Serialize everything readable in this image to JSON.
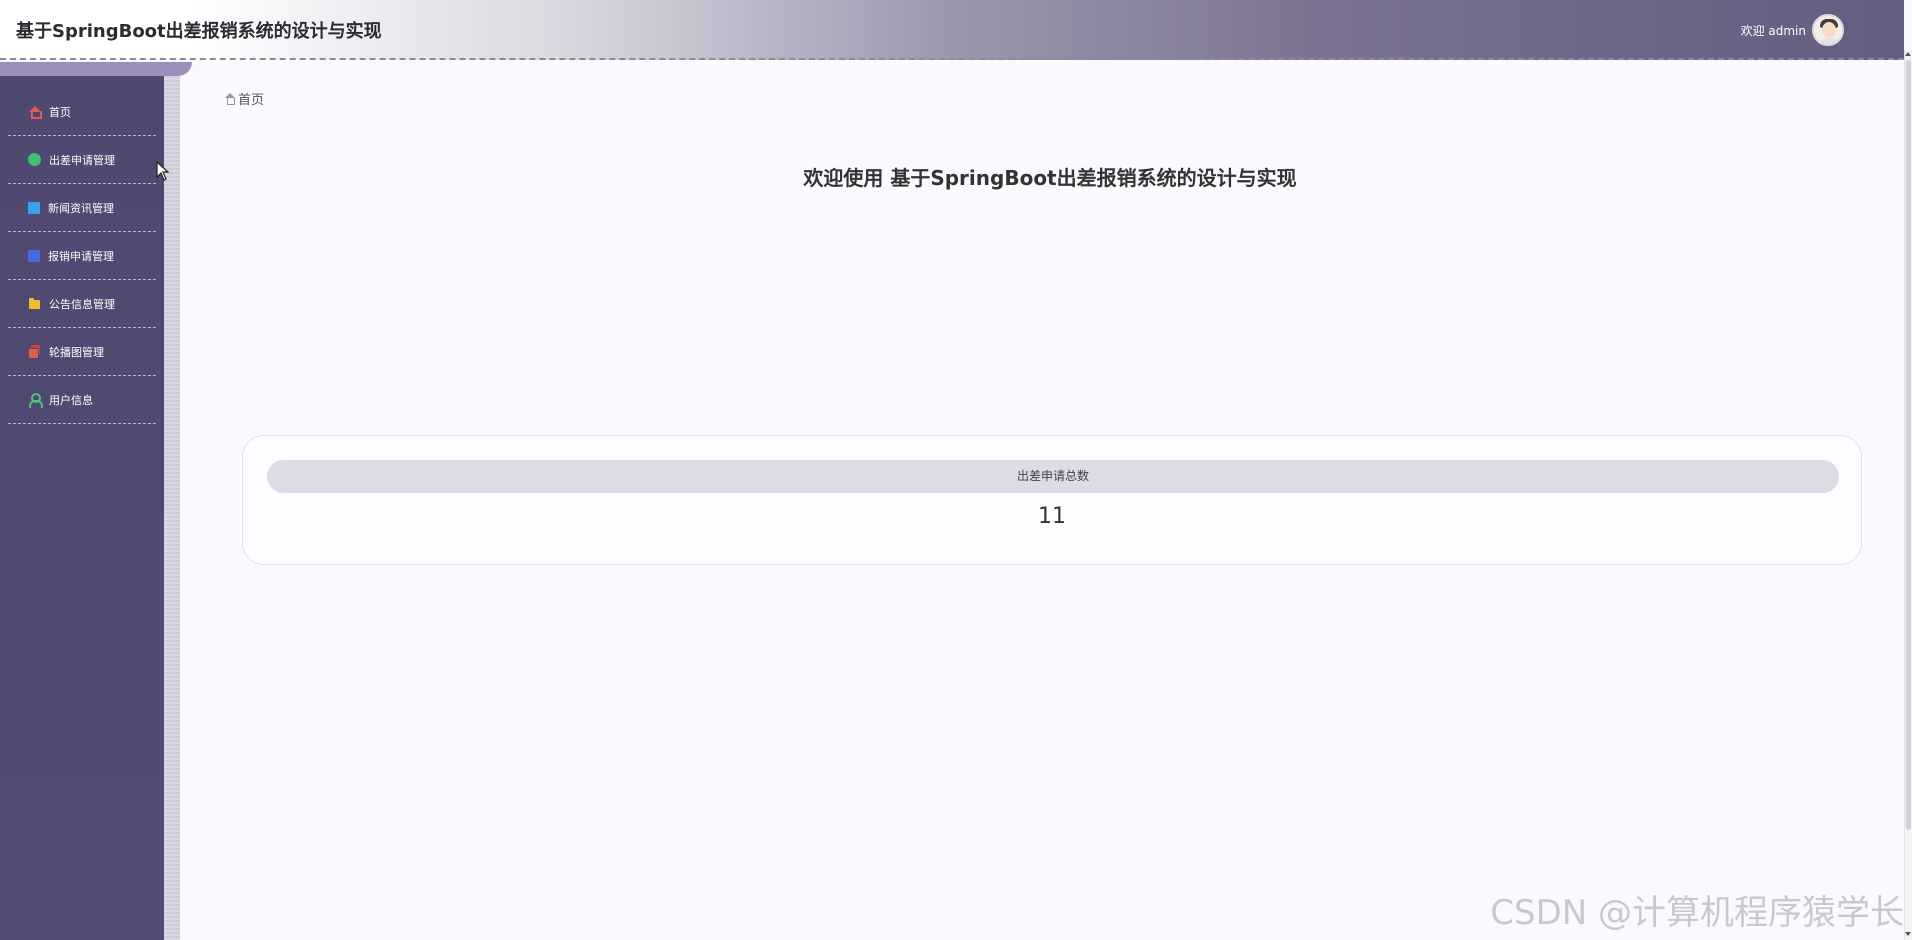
{
  "header": {
    "app_title": "基于SpringBoot出差报销系统的设计与实现",
    "welcome_user": "欢迎 admin"
  },
  "sidebar": {
    "items": [
      {
        "label": "首页",
        "icon": "home-icon",
        "color": "#e05a55"
      },
      {
        "label": "出差申请管理",
        "icon": "circle-icon",
        "color": "#3fbf6f"
      },
      {
        "label": "新闻资讯管理",
        "icon": "square-icon",
        "color": "#3aa0e8"
      },
      {
        "label": "报销申请管理",
        "icon": "square-icon",
        "color": "#4a6ae0"
      },
      {
        "label": "公告信息管理",
        "icon": "folder-icon",
        "color": "#f0bd2e"
      },
      {
        "label": "轮播图管理",
        "icon": "gallery-icon",
        "color": "#c9463e"
      },
      {
        "label": "用户信息",
        "icon": "user-icon",
        "color": "#4cc77a"
      }
    ]
  },
  "breadcrumb": {
    "home_label": "首页"
  },
  "main": {
    "welcome_title": "欢迎使用 基于SpringBoot出差报销系统的设计与实现",
    "stat_card": {
      "label": "出差申请总数",
      "value": "11"
    }
  },
  "watermark": "CSDN @计算机程序猿学长",
  "colors": {
    "sidebar_bg": "#524c74",
    "header_gradient_end": "#645c82",
    "stat_header_bg": "#dedbe6"
  }
}
